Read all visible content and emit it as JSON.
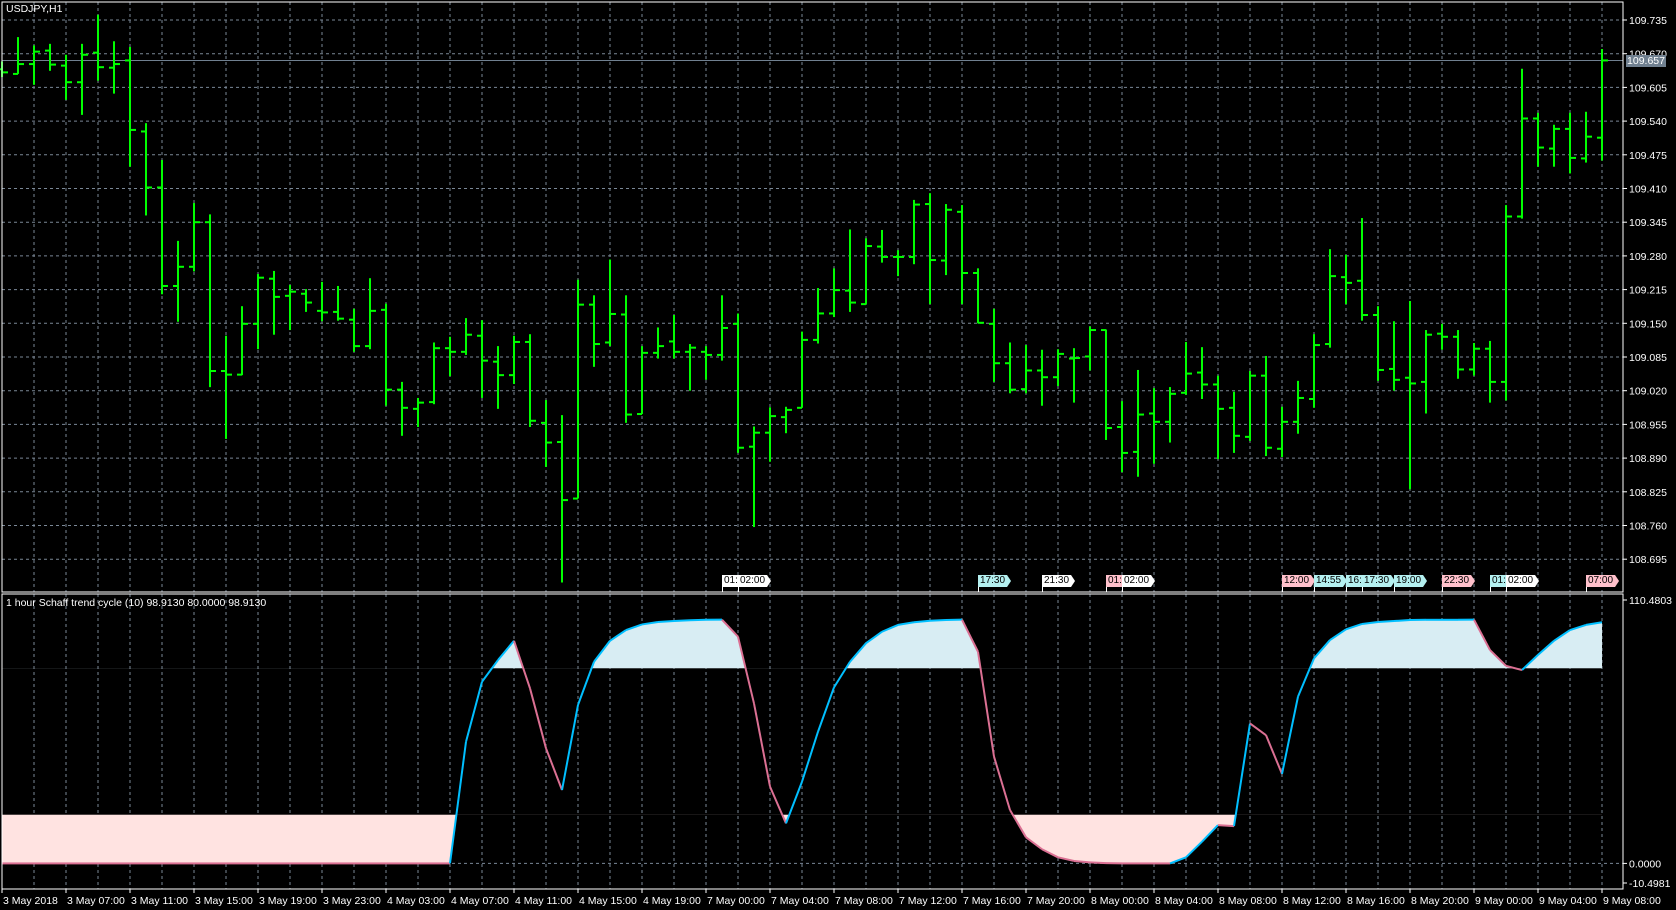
{
  "window": {
    "title": "USDJPY,H1"
  },
  "colors": {
    "bar": "#00ff00",
    "grid": "#7a8796",
    "stc_up": "#00bfff",
    "stc_down": "#db7093",
    "fill_high": "#d8edf3",
    "fill_low": "#ffe3e1",
    "price_line": "#708090"
  },
  "price_axis": {
    "labels": [
      "109.735",
      "109.670",
      "109.605",
      "109.540",
      "109.475",
      "109.410",
      "109.345",
      "109.280",
      "109.215",
      "109.150",
      "109.085",
      "109.020",
      "108.955",
      "108.890",
      "108.825",
      "108.760",
      "108.695"
    ],
    "current_price": "109.657"
  },
  "indicator": {
    "title": "1 hour Schaff trend cycle (10) 98.9130 80.0000 98.9130",
    "axis_labels": {
      "max": "110.4803",
      "zero": "0.0000",
      "min": "-10.4981"
    },
    "range": [
      -10.4981,
      110.4803
    ],
    "levels": [
      20,
      80
    ]
  },
  "time_axis": {
    "labels": [
      "3 May 2018",
      "3 May 07:00",
      "3 May 11:00",
      "3 May 15:00",
      "3 May 19:00",
      "3 May 23:00",
      "4 May 03:00",
      "4 May 07:00",
      "4 May 11:00",
      "4 May 15:00",
      "4 May 19:00",
      "7 May 00:00",
      "7 May 04:00",
      "7 May 08:00",
      "7 May 12:00",
      "7 May 16:00",
      "7 May 20:00",
      "8 May 00:00",
      "8 May 04:00",
      "8 May 08:00",
      "8 May 12:00",
      "8 May 16:00",
      "8 May 20:00",
      "9 May 00:00",
      "9 May 04:00",
      "9 May 08:00"
    ],
    "bars_per_label": 4
  },
  "events": [
    {
      "text": "01:",
      "color": "#ffffff",
      "bar": 45
    },
    {
      "text": "02:00",
      "color": "#ffffff",
      "bar": 46
    },
    {
      "text": "17:30",
      "color": "#b4f0f0",
      "bar": 61
    },
    {
      "text": "21:30",
      "color": "#ffffff",
      "bar": 65
    },
    {
      "text": "01:",
      "color": "#ffc0cb",
      "bar": 69
    },
    {
      "text": "02:00",
      "color": "#ffffff",
      "bar": 70
    },
    {
      "text": "12:00",
      "color": "#ffc0cb",
      "bar": 80
    },
    {
      "text": "14:55",
      "color": "#b4f0f0",
      "bar": 82
    },
    {
      "text": "16:",
      "color": "#b4f0f0",
      "bar": 84
    },
    {
      "text": "17:30",
      "color": "#b4f0f0",
      "bar": 85
    },
    {
      "text": "19:00",
      "color": "#b4f0f0",
      "bar": 87
    },
    {
      "text": "22:30",
      "color": "#ffc0cb",
      "bar": 90
    },
    {
      "text": "01:",
      "color": "#b4f0f0",
      "bar": 93
    },
    {
      "text": "02:00",
      "color": "#ffffff",
      "bar": 94
    },
    {
      "text": "07:00",
      "color": "#ffc0cb",
      "bar": 99
    }
  ],
  "chart_data": {
    "type": "ohlc",
    "symbol": "USDJPY",
    "timeframe": "H1",
    "ylim": [
      108.66,
      109.77
    ],
    "ohlc": [
      [
        109.64,
        109.655,
        109.625,
        109.634
      ],
      [
        109.631,
        109.702,
        109.631,
        109.65
      ],
      [
        109.65,
        109.686,
        109.61,
        109.674
      ],
      [
        109.676,
        109.689,
        109.637,
        109.649
      ],
      [
        109.647,
        109.668,
        109.581,
        109.615
      ],
      [
        109.615,
        109.689,
        109.552,
        109.668
      ],
      [
        109.672,
        109.745,
        109.618,
        109.644
      ],
      [
        109.643,
        109.694,
        109.593,
        109.65
      ],
      [
        109.657,
        109.683,
        109.452,
        109.523
      ],
      [
        109.52,
        109.536,
        109.358,
        109.412
      ],
      [
        109.412,
        109.465,
        109.206,
        109.222
      ],
      [
        109.222,
        109.309,
        109.153,
        109.259
      ],
      [
        109.259,
        109.382,
        109.25,
        109.345
      ],
      [
        109.345,
        109.36,
        109.027,
        109.058
      ],
      [
        109.058,
        109.126,
        108.927,
        109.051
      ],
      [
        109.051,
        109.183,
        109.05,
        109.149
      ],
      [
        109.149,
        109.245,
        109.1,
        109.238
      ],
      [
        109.236,
        109.251,
        109.128,
        109.201
      ],
      [
        109.203,
        109.224,
        109.137,
        109.211
      ],
      [
        109.207,
        109.216,
        109.172,
        109.19
      ],
      [
        109.174,
        109.23,
        109.154,
        109.171
      ],
      [
        109.172,
        109.222,
        109.155,
        109.159
      ],
      [
        109.157,
        109.178,
        109.095,
        109.106
      ],
      [
        109.106,
        109.237,
        109.1,
        109.174
      ],
      [
        109.176,
        109.188,
        108.991,
        109.022
      ],
      [
        109.022,
        109.037,
        108.933,
        108.987
      ],
      [
        108.985,
        109.006,
        108.95,
        108.997
      ],
      [
        108.998,
        109.113,
        108.994,
        109.102
      ],
      [
        109.102,
        109.124,
        109.048,
        109.095
      ],
      [
        109.095,
        109.16,
        109.089,
        109.128
      ],
      [
        109.126,
        109.156,
        109.006,
        109.078
      ],
      [
        109.076,
        109.106,
        108.985,
        109.05
      ],
      [
        109.05,
        109.126,
        109.033,
        109.114
      ],
      [
        109.114,
        109.129,
        108.95,
        108.962
      ],
      [
        108.958,
        109.002,
        108.873,
        108.92
      ],
      [
        108.921,
        108.973,
        108.65,
        108.809
      ],
      [
        108.812,
        109.234,
        108.812,
        109.186
      ],
      [
        109.186,
        109.204,
        109.066,
        109.11
      ],
      [
        109.113,
        109.273,
        109.106,
        109.168
      ],
      [
        109.167,
        109.204,
        108.958,
        108.974
      ],
      [
        108.975,
        109.106,
        108.975,
        109.093
      ],
      [
        109.093,
        109.142,
        109.082,
        109.106
      ],
      [
        109.115,
        109.166,
        109.082,
        109.095
      ],
      [
        109.095,
        109.11,
        109.02,
        109.103
      ],
      [
        109.095,
        109.106,
        109.041,
        109.089
      ],
      [
        109.089,
        109.204,
        109.078,
        109.141
      ],
      [
        109.149,
        109.169,
        108.9,
        108.91
      ],
      [
        108.912,
        108.951,
        108.757,
        108.939
      ],
      [
        108.939,
        108.988,
        108.883,
        108.971
      ],
      [
        108.969,
        108.989,
        108.938,
        108.983
      ],
      [
        108.987,
        109.134,
        108.987,
        109.118
      ],
      [
        109.118,
        109.218,
        109.111,
        109.169
      ],
      [
        109.169,
        109.256,
        109.162,
        109.214
      ],
      [
        109.213,
        109.331,
        109.172,
        109.19
      ],
      [
        109.187,
        109.314,
        109.187,
        109.299
      ],
      [
        109.298,
        109.33,
        109.267,
        109.278
      ],
      [
        109.278,
        109.291,
        109.241,
        109.278
      ],
      [
        109.278,
        109.388,
        109.264,
        109.379
      ],
      [
        109.38,
        109.401,
        109.187,
        109.272
      ],
      [
        109.271,
        109.38,
        109.243,
        109.369
      ],
      [
        109.365,
        109.378,
        109.187,
        109.247
      ],
      [
        109.247,
        109.256,
        109.15,
        109.151
      ],
      [
        109.149,
        109.178,
        109.037,
        109.073
      ],
      [
        109.073,
        109.113,
        109.015,
        109.022
      ],
      [
        109.023,
        109.108,
        109.015,
        109.059
      ],
      [
        109.059,
        109.099,
        108.991,
        109.046
      ],
      [
        109.046,
        109.1,
        109.029,
        109.091
      ],
      [
        109.082,
        109.102,
        108.997,
        109.083
      ],
      [
        109.086,
        109.144,
        109.059,
        109.137
      ],
      [
        109.137,
        109.138,
        108.925,
        108.948
      ],
      [
        108.95,
        109.0,
        108.863,
        108.9
      ],
      [
        108.902,
        109.06,
        108.854,
        108.974
      ],
      [
        108.976,
        109.025,
        108.879,
        108.96
      ],
      [
        108.96,
        109.027,
        108.92,
        109.014
      ],
      [
        109.016,
        109.114,
        109.012,
        109.053
      ],
      [
        109.055,
        109.104,
        109.004,
        109.032
      ],
      [
        109.032,
        109.049,
        108.888,
        108.985
      ],
      [
        108.987,
        109.018,
        108.9,
        108.933
      ],
      [
        108.931,
        109.058,
        108.923,
        109.049
      ],
      [
        109.049,
        109.087,
        108.894,
        108.91
      ],
      [
        108.908,
        108.989,
        108.892,
        108.96
      ],
      [
        108.96,
        109.039,
        108.937,
        109.006
      ],
      [
        109.004,
        109.129,
        108.987,
        109.108
      ],
      [
        109.11,
        109.293,
        109.103,
        109.241
      ],
      [
        109.239,
        109.282,
        109.187,
        109.228
      ],
      [
        109.232,
        109.353,
        109.155,
        109.166
      ],
      [
        109.166,
        109.183,
        109.039,
        109.06
      ],
      [
        109.062,
        109.154,
        109.02,
        109.041
      ],
      [
        109.045,
        109.193,
        108.83,
        109.034
      ],
      [
        109.037,
        109.137,
        108.976,
        109.128
      ],
      [
        109.13,
        109.149,
        109.099,
        109.124
      ],
      [
        109.124,
        109.137,
        109.043,
        109.061
      ],
      [
        109.061,
        109.112,
        109.049,
        109.101
      ],
      [
        109.101,
        109.116,
        108.997,
        109.037
      ],
      [
        109.037,
        109.378,
        109.001,
        109.356
      ],
      [
        109.356,
        109.641,
        109.352,
        109.545
      ],
      [
        109.545,
        109.556,
        109.452,
        109.489
      ],
      [
        109.487,
        109.533,
        109.452,
        109.525
      ],
      [
        109.525,
        109.556,
        109.439,
        109.469
      ],
      [
        109.468,
        109.558,
        109.46,
        109.51
      ],
      [
        109.508,
        109.679,
        109.464,
        109.657
      ]
    ],
    "stc": [
      0,
      0,
      0,
      0,
      0,
      0,
      0,
      0,
      0,
      0,
      0,
      0,
      0,
      0,
      0,
      0,
      0,
      0,
      0,
      0,
      0,
      0,
      0,
      0,
      0,
      0,
      0,
      0,
      0,
      49.9,
      74.5,
      83.4,
      91.3,
      71.8,
      47.2,
      30.1,
      65.0,
      82.7,
      91.3,
      95.7,
      98.0,
      99.0,
      99.4,
      99.7,
      99.9,
      99.95,
      93.0,
      65.6,
      31.5,
      16.4,
      33.5,
      54.0,
      72.2,
      82.7,
      90.3,
      95.0,
      97.8,
      98.9,
      99.5,
      99.8,
      99.95,
      86.8,
      43.8,
      21.9,
      10.7,
      5.8,
      2.5,
      1.0,
      0.4,
      0.1,
      0,
      0,
      0,
      0,
      2.5,
      8.9,
      15.7,
      15.3,
      57.4,
      52.6,
      36.7,
      68.4,
      84.1,
      91.6,
      96.0,
      98.2,
      99.0,
      99.4,
      99.8,
      99.9,
      99.9,
      99.9,
      99.95,
      87.5,
      81.0,
      79.3,
      85.5,
      91.3,
      95.7,
      97.8,
      98.913
    ]
  }
}
